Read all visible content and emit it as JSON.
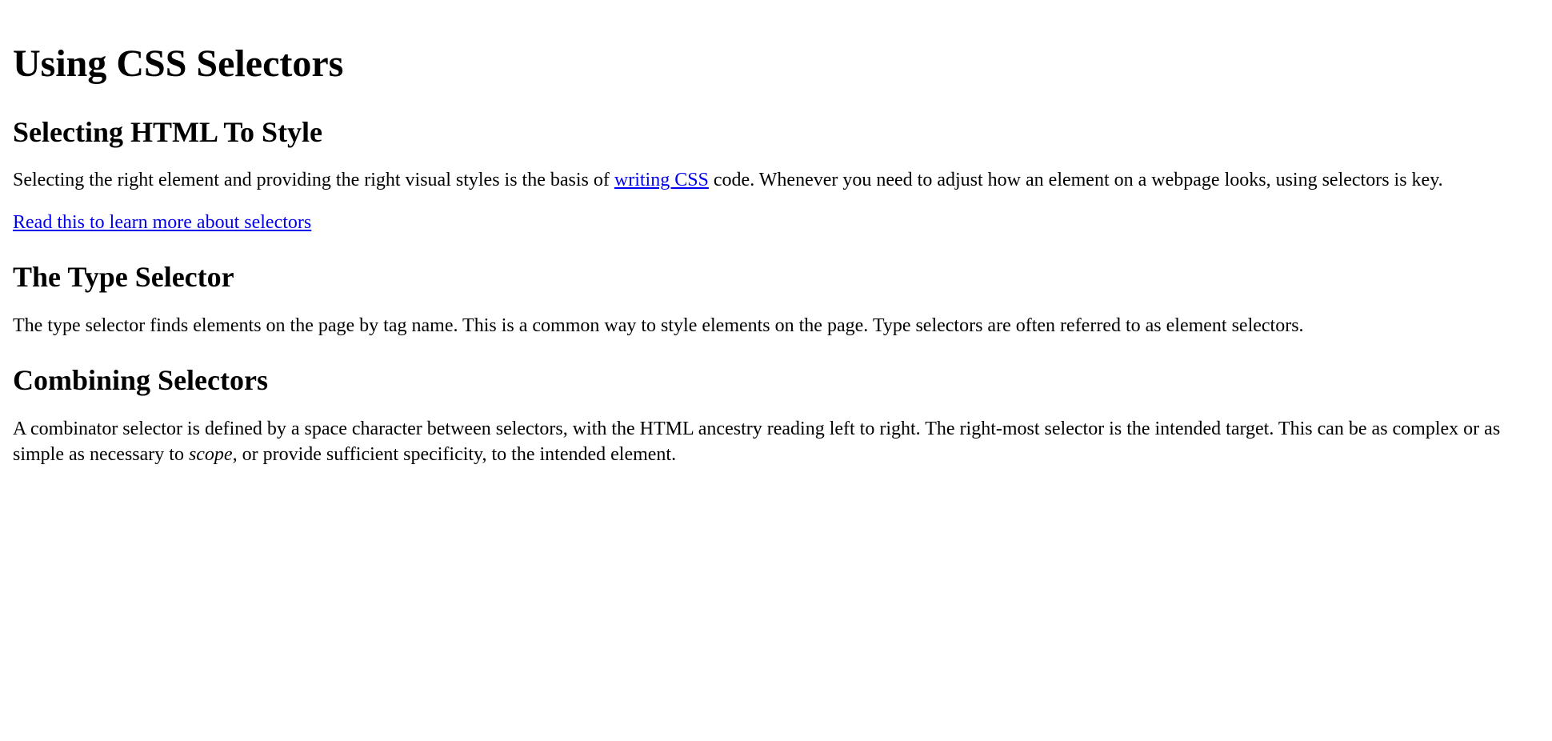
{
  "title": "Using CSS Selectors",
  "sections": {
    "selecting": {
      "heading": "Selecting HTML To Style",
      "paragraph_pre": "Selecting the right element and providing the right visual styles is the basis of ",
      "link_text": "writing CSS",
      "paragraph_post": " code. Whenever you need to adjust how an element on a webpage looks, using selectors is key.",
      "learn_more_link": "Read this to learn more about selectors"
    },
    "type_selector": {
      "heading": "The Type Selector",
      "paragraph": "The type selector finds elements on the page by tag name. This is a common way to style elements on the page. Type selectors are often referred to as element selectors."
    },
    "combining": {
      "heading": "Combining Selectors",
      "paragraph_pre": "A combinator selector is defined by a space character between selectors, with the HTML ancestry reading left to right. The right-most selector is the intended target. This can be as complex or as simple as necessary to ",
      "emphasis": "scope",
      "paragraph_post": ", or provide sufficient specificity, to the intended element."
    }
  }
}
